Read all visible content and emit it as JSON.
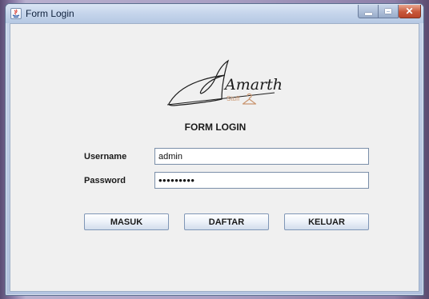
{
  "window": {
    "title": "Form Login",
    "icon": "java-app-icon",
    "controls": [
      "minimize",
      "maximize",
      "close"
    ]
  },
  "logo": {
    "brand": "Amartha",
    "tagline": "Stuff",
    "icon": "clothes-hanger-icon"
  },
  "form": {
    "title": "FORM LOGIN",
    "username_label": "Username",
    "username_value": "admin",
    "password_label": "Password",
    "password_value": "•••••••••"
  },
  "buttons": {
    "masuk": "MASUK",
    "daftar": "DAFTAR",
    "keluar": "KELUAR"
  },
  "colors": {
    "accent_logo": "#c9956f",
    "close_button": "#c8573a"
  }
}
